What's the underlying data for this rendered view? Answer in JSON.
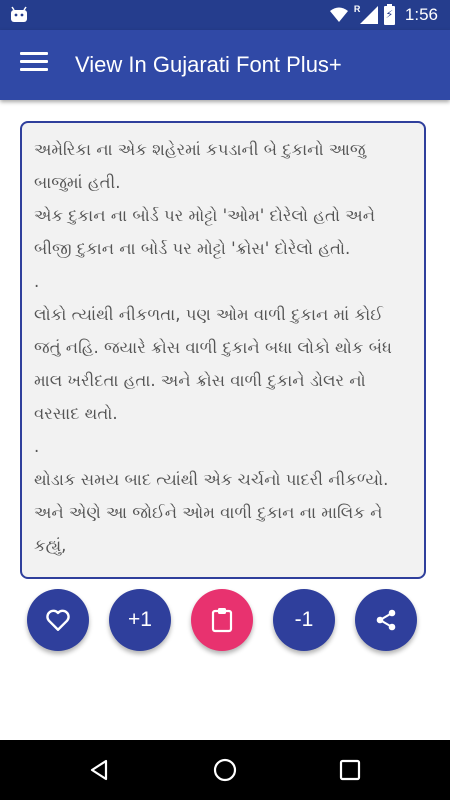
{
  "status_bar": {
    "time": "1:56",
    "signal_label": "R",
    "battery_label": "⚡",
    "icons": [
      "android-icon",
      "wifi-icon",
      "signal-icon",
      "battery-icon"
    ]
  },
  "app_bar": {
    "title": "View In Gujarati Font Plus+",
    "menu_icon": "menu-icon"
  },
  "content": {
    "paragraphs": [
      "અમેરિકા ના એક શહેરમાં કપડાની બે દુકાનો આજુ બાજુમાં હતી.",
      "એક દુકાન ના બોર્ડ પર મોટ્ટો 'ઓમ' દોરેલો હતો અને બીજી દુકાન ના બોર્ડ પર મોટ્ટો 'ક્રોસ' દોરેલો હતો.",
      ".",
      "લોકો ત્યાંથી નીકળતા, પણ ઓમ વાળી દુકાન માં કોઈ જતું નહિ. જયારે ક્રોસ વાળી દુકાને બધા લોકો થોક બંધ માલ ખરીદતા હતા. અને ક્રોસ વાળી દુકાને ડોલર નો વરસાદ થતો.",
      ".",
      "થોડાક સમય બાદ ત્યાંથી એક ચર્ચનો પાદરી નીકળ્યો. અને એણે આ જોઈને ઓમ વાળી દુકાન ના માલિક ને કહ્યું,"
    ]
  },
  "actions": {
    "like_icon": "heart-icon",
    "plus_label": "+1",
    "copy_icon": "clipboard-icon",
    "minus_label": "-1",
    "share_icon": "share-icon"
  },
  "colors": {
    "primary": "#3049a6",
    "primary_dark": "#253d8d",
    "button": "#2f3f9c",
    "accent": "#e8326f"
  },
  "nav_bar": {
    "icons": [
      "back-icon",
      "home-icon",
      "recents-icon"
    ]
  }
}
